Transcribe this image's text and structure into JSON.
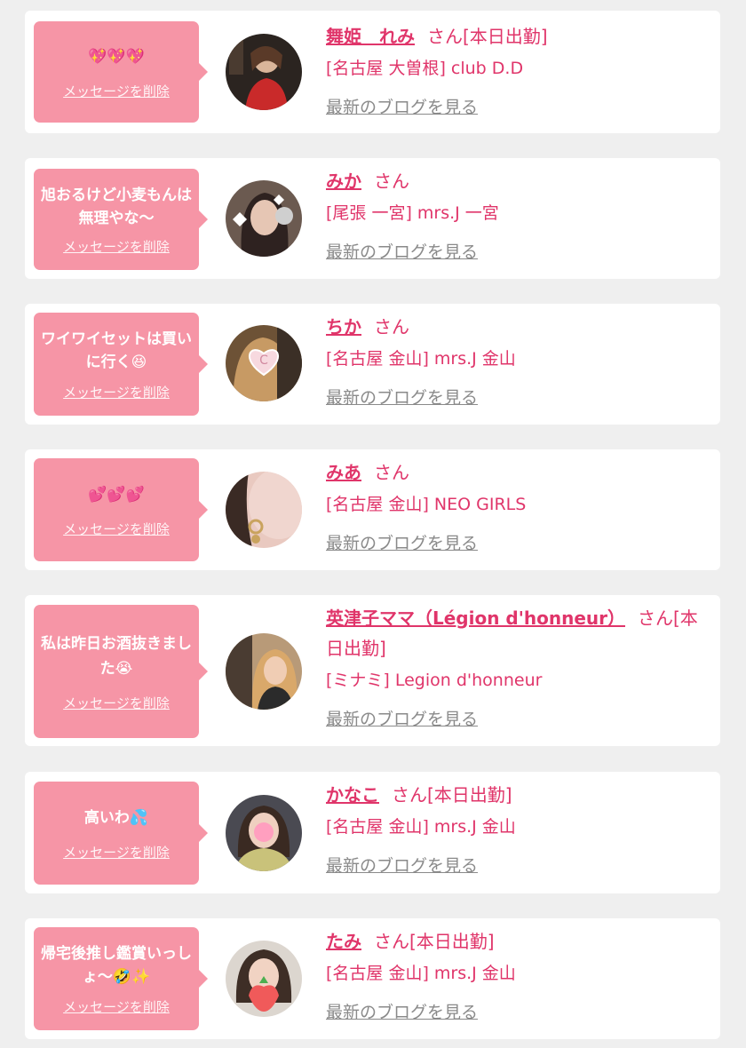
{
  "delete_label": "メッセージを削除",
  "san_suffix": "さん",
  "blog_label": "最新のブログを見る",
  "colors": {
    "bubble": "#f695a6",
    "accent": "#e0356a",
    "background": "#efefef"
  },
  "messages": [
    {
      "bubble_text": "💖💖💖",
      "name": "舞姫　れみ",
      "suffix": "[本日出勤]",
      "shop": "[名古屋 大曽根] club D.D"
    },
    {
      "bubble_text": "旭おるけど小麦もんは無理やな〜",
      "name": "みか",
      "suffix": "",
      "shop": "[尾張 一宮] mrs.J 一宮"
    },
    {
      "bubble_text": "ワイワイセットは買いに行く😆",
      "name": "ちか",
      "suffix": "",
      "shop": "[名古屋 金山] mrs.J 金山"
    },
    {
      "bubble_text": "💕💕💕",
      "name": "みあ",
      "suffix": "",
      "shop": "[名古屋 金山] NEO GIRLS"
    },
    {
      "bubble_text": "私は昨日お酒抜きました😭",
      "name": "英津子ママ（Légion d'honneur）",
      "suffix": "[本日出勤]",
      "shop": "[ミナミ] Legion d'honneur"
    },
    {
      "bubble_text": "高いわ💦",
      "name": "かなこ",
      "suffix": "[本日出勤]",
      "shop": "[名古屋 金山] mrs.J 金山"
    },
    {
      "bubble_text": "帰宅後推し鑑賞いっしょ〜🤣✨",
      "name": "たみ",
      "suffix": "[本日出勤]",
      "shop": "[名古屋 金山] mrs.J 金山"
    }
  ]
}
